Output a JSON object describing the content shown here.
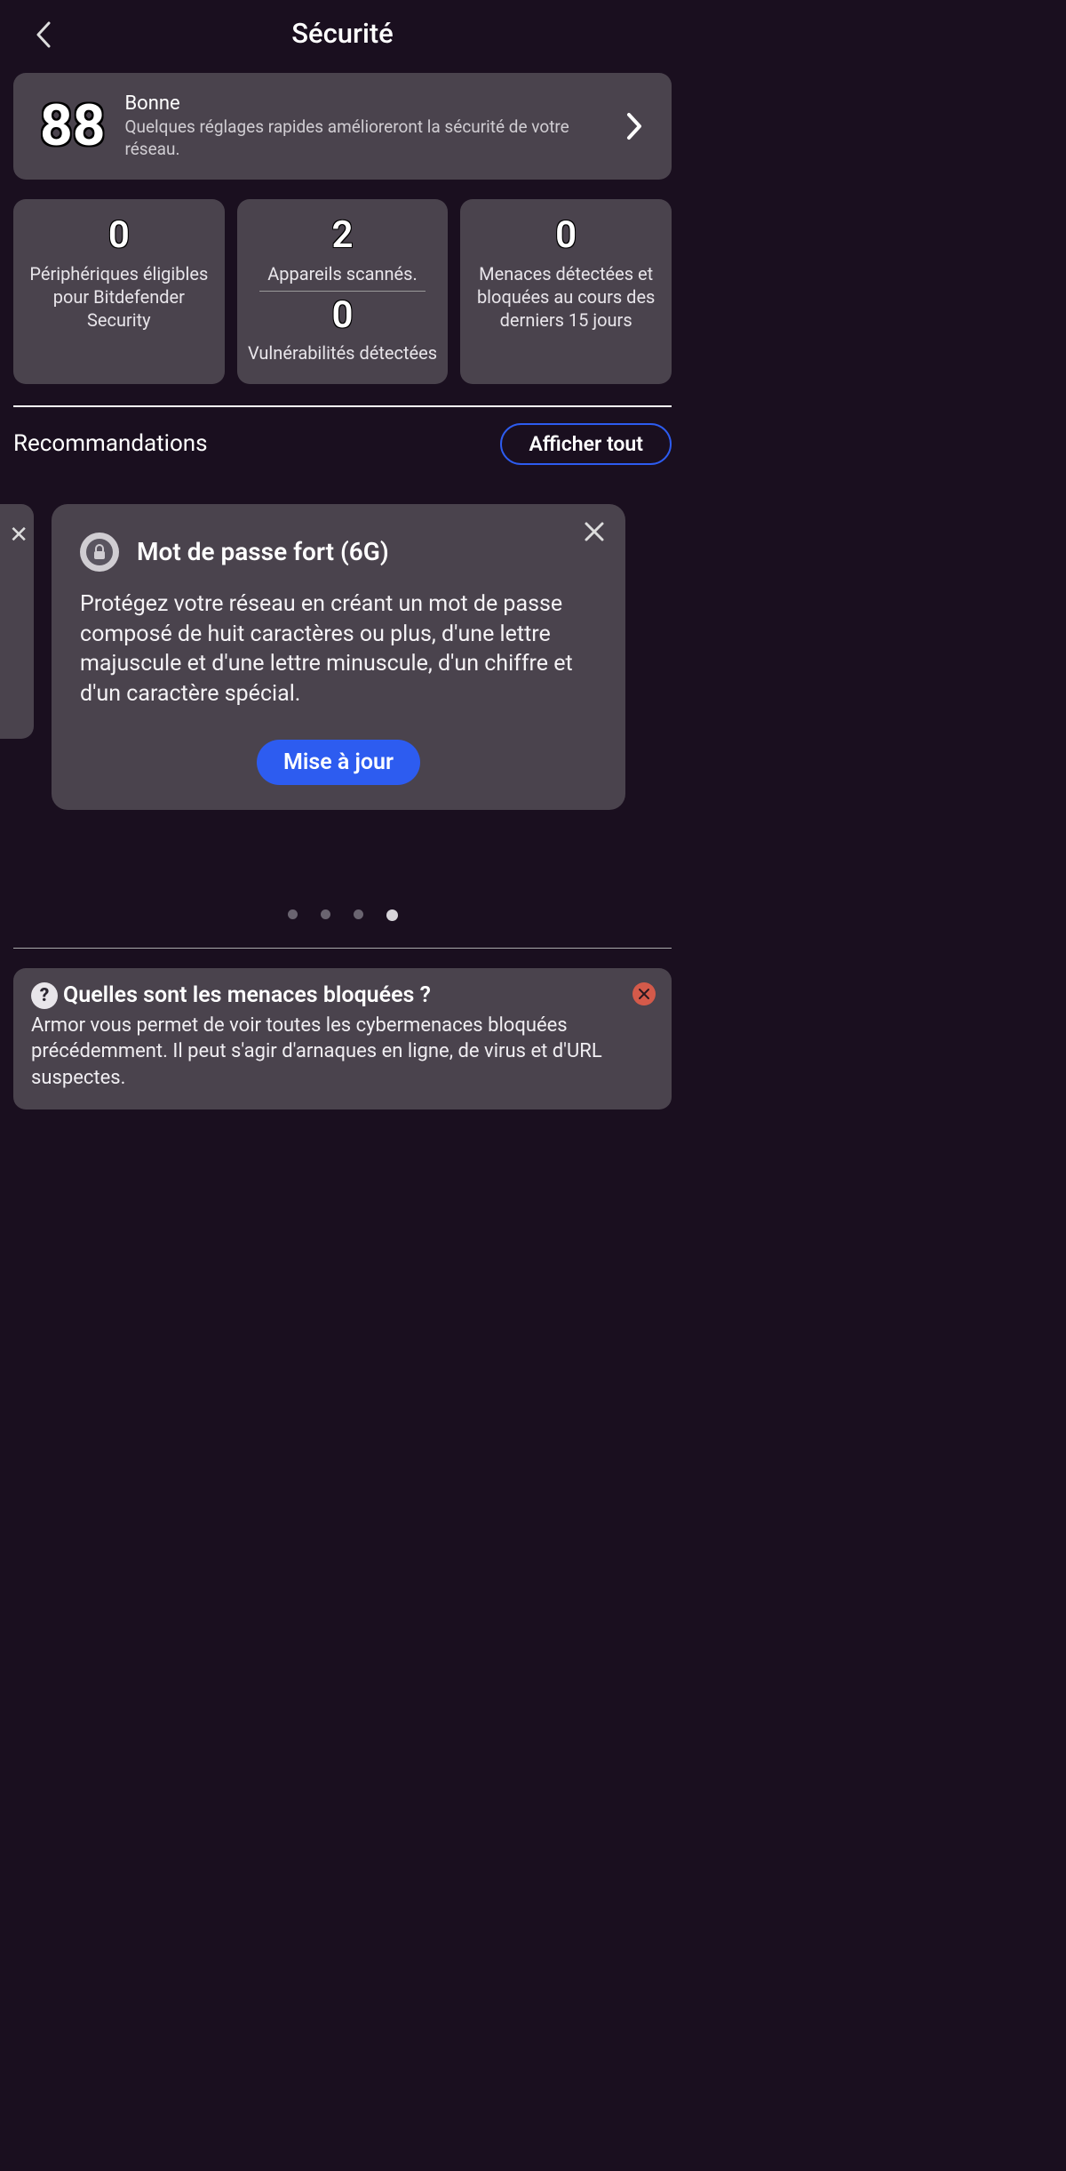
{
  "header": {
    "title": "Sécurité"
  },
  "score_card": {
    "score": "88",
    "status": "Bonne",
    "description": "Quelques réglages rapides amélioreront la sécurité de votre réseau."
  },
  "stats": {
    "left": {
      "value": "0",
      "label": "Périphériques éligibles pour Bitdefender Security"
    },
    "middle": {
      "top_value": "2",
      "top_label": "Appareils scannés.",
      "bottom_value": "0",
      "bottom_label": "Vulnérabilités détectées"
    },
    "right": {
      "value": "0",
      "label": "Menaces détectées et bloquées au cours des derniers 15 jours"
    }
  },
  "recommendations": {
    "heading": "Recommandations",
    "show_all": "Afficher tout",
    "card": {
      "title": "Mot de passe fort (6G)",
      "body": "Protégez votre réseau en créant un mot de passe composé de huit caractères ou plus, d'une lettre majuscule et d'une lettre minuscule, d'un chiffre et d'un caractère spécial.",
      "cta": "Mise à jour"
    },
    "active_dot_index": 3
  },
  "info": {
    "title": "Quelles sont les menaces bloquées ?",
    "body": "Armor vous permet de voir toutes les cybermenaces bloquées précédemment. Il peut s'agir d'arnaques en ligne, de virus et d'URL suspectes."
  }
}
